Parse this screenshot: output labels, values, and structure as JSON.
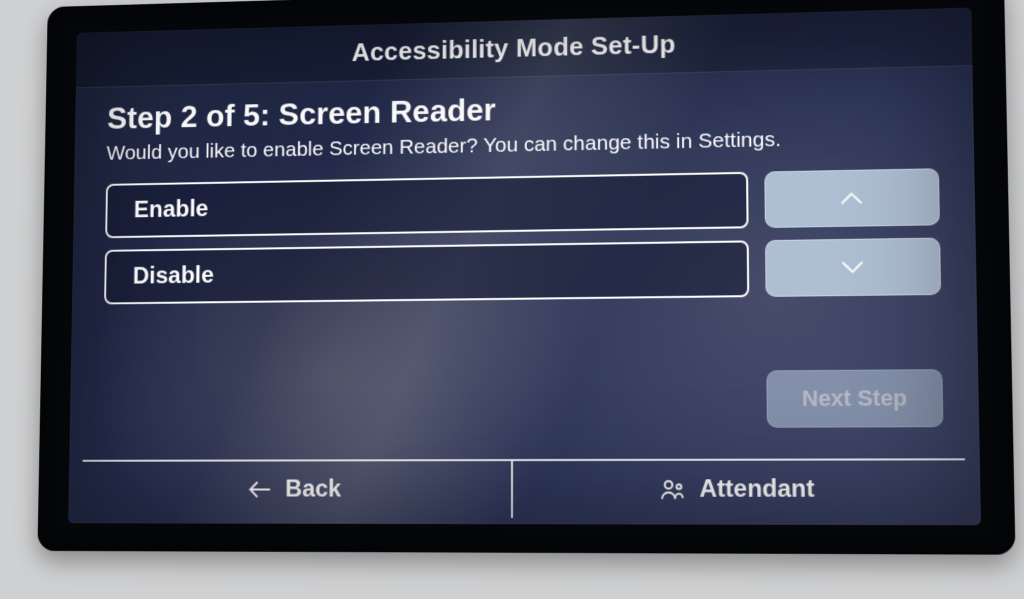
{
  "header": {
    "title": "Accessibility Mode Set-Up"
  },
  "main": {
    "heading": "Step 2 of 5: Screen Reader",
    "description": "Would you like to enable Screen Reader? You can change this in Settings.",
    "options": {
      "enable_label": "Enable",
      "disable_label": "Disable"
    },
    "nav_buttons": {
      "scroll_up": "",
      "scroll_down": "",
      "next_step_label": "Next Step"
    }
  },
  "footer": {
    "back_label": "Back",
    "attendant_label": "Attendant"
  }
}
